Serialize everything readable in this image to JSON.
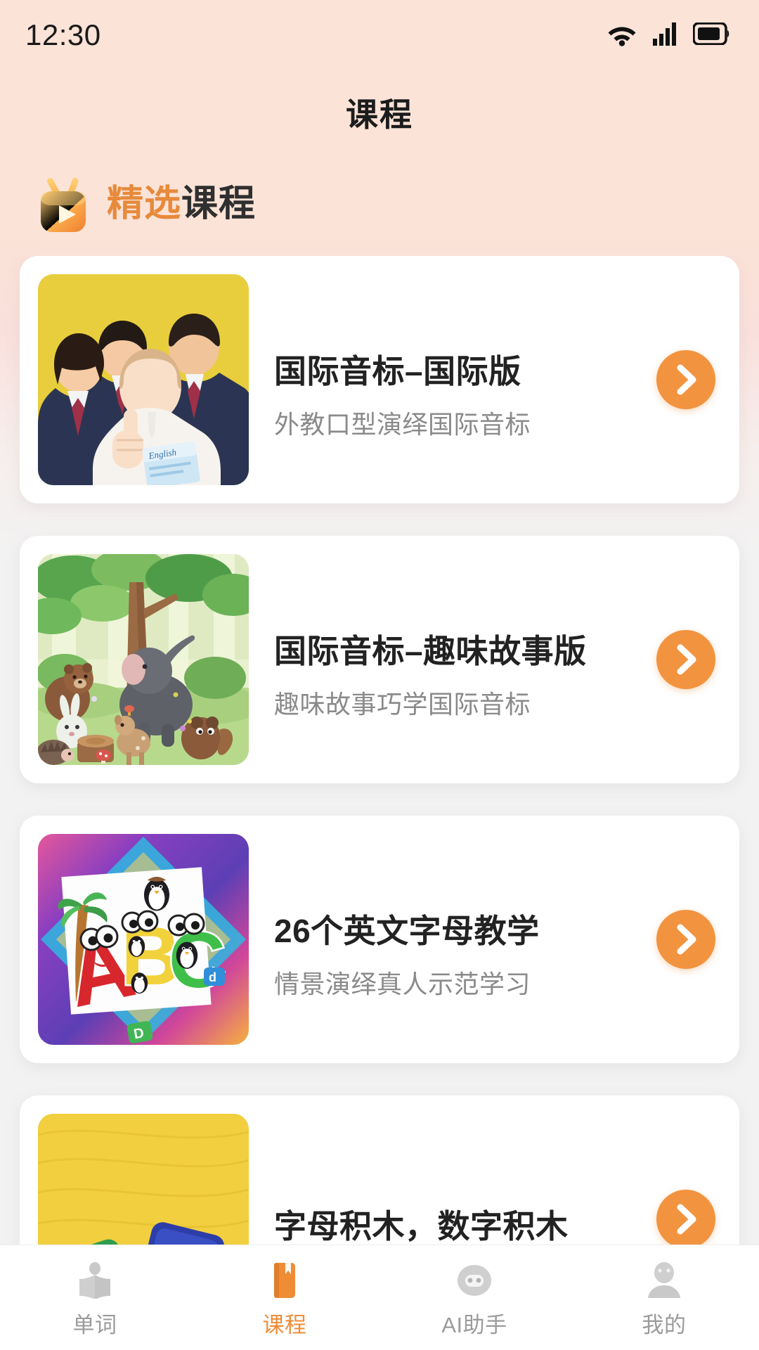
{
  "status_bar": {
    "time": "12:30",
    "icons": [
      "wifi-icon",
      "cellular-signal-icon",
      "battery-icon"
    ]
  },
  "header": {
    "title": "课程"
  },
  "section": {
    "icon": "tv-play-icon",
    "title_highlight": "精选",
    "title_rest": "课程",
    "highlight_color": "#e78a3c",
    "rest_color": "#2f2f2f"
  },
  "courses": [
    {
      "title": "国际音标–国际版",
      "subtitle": "外教口型演绎国际音标",
      "thumb": "students-photo-yellow",
      "action_icon": "chevron-right-icon"
    },
    {
      "title": "国际音标–趣味故事版",
      "subtitle": "趣味故事巧学国际音标",
      "thumb": "forest-animals-illustration",
      "action_icon": "chevron-right-icon"
    },
    {
      "title": "26个英文字母教学",
      "subtitle": "情景演绎真人示范学习",
      "thumb": "abc-letters-colorful",
      "action_icon": "chevron-right-icon"
    },
    {
      "title": "字母积木，数字积木",
      "subtitle": "",
      "thumb": "letter-blocks-yellow",
      "action_icon": "chevron-right-icon"
    }
  ],
  "tabbar": {
    "active_color": "#ef8c36",
    "inactive_color": "#9b9b9b",
    "items": [
      {
        "label": "单词",
        "icon": "open-book-icon",
        "active": false
      },
      {
        "label": "课程",
        "icon": "book-mark-icon",
        "active": true
      },
      {
        "label": "AI助手",
        "icon": "robot-face-icon",
        "active": false
      },
      {
        "label": "我的",
        "icon": "person-icon",
        "active": false
      }
    ]
  }
}
